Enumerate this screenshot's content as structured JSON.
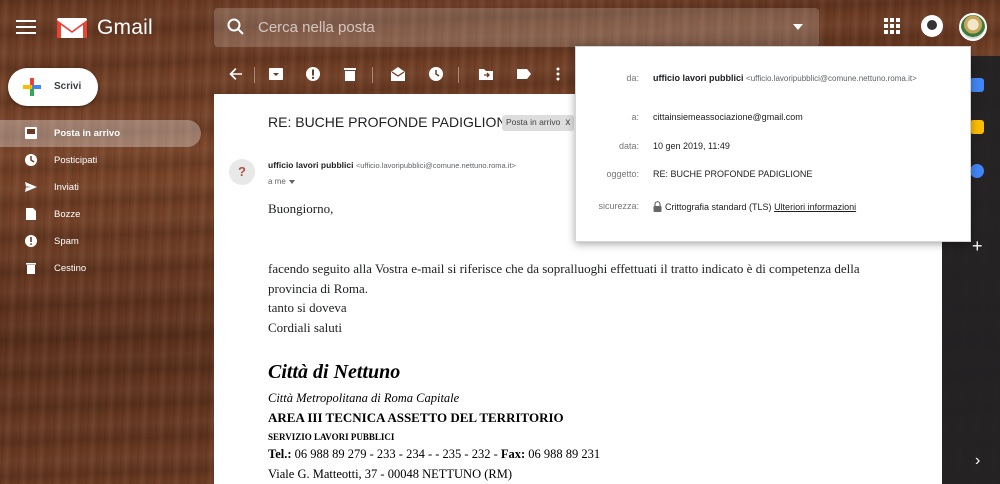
{
  "app": {
    "name": "Gmail"
  },
  "search": {
    "placeholder": "Cerca nella posta"
  },
  "compose": {
    "label": "Scrivi"
  },
  "nav": {
    "items": [
      {
        "label": "Posta in arrivo",
        "icon": "inbox-icon"
      },
      {
        "label": "Posticipati",
        "icon": "clock-icon"
      },
      {
        "label": "Inviati",
        "icon": "send-icon"
      },
      {
        "label": "Bozze",
        "icon": "draft-icon"
      },
      {
        "label": "Spam",
        "icon": "spam-icon"
      },
      {
        "label": "Cestino",
        "icon": "trash-icon"
      }
    ]
  },
  "toolbar": {
    "icons": [
      "back-arrow-icon",
      "archive-icon",
      "report-spam-icon",
      "delete-icon",
      "mark-unread-icon",
      "snooze-icon",
      "move-to-icon",
      "label-icon",
      "more-icon"
    ]
  },
  "email": {
    "subject": "RE: BUCHE PROFONDE PADIGLIONE",
    "label_chip": "Posta in arrivo",
    "label_chip_close": "x",
    "sender_initial": "?",
    "sender_name": "ufficio lavori pubblici",
    "sender_email": "<ufficio.lavoripubblici@comune.nettuno.roma.it>",
    "to_line": "a me",
    "greeting": "Buongiorno,",
    "body_lines": [
      "facendo seguito alla Vostra e-mail si riferisce che da sopralluoghi effettuati il tratto indicato è di competenza della",
      "provincia di Roma.",
      "tanto si doveva",
      "Cordiali saluti"
    ],
    "signature": {
      "title": "Città di Nettuno",
      "line1": "Città Metropolitana di Roma Capitale",
      "line2": "AREA III TECNICA ASSETTO DEL TERRITORIO",
      "line3": "SERVIZIO LAVORI PUBBLICI",
      "tel_label": "Tel.:",
      "tel_value": " 06 988 89 279 - 233 - 234 - - 235 - 232  - ",
      "fax_label": "Fax:",
      "fax_value": " 06 988 89 231",
      "address": "Viale G. Matteotti, 37 - 00048 NETTUNO (RM)"
    }
  },
  "details_popup": {
    "from_key": "da:",
    "from_name": "ufficio lavori pubblici",
    "from_email": "<ufficio.lavoripubblici@comune.nettuno.roma.it>",
    "to_key": "a:",
    "to_value": "cittainsiemeassociazione@gmail.com",
    "date_key": "data:",
    "date_value": "10 gen 2019, 11:49",
    "subject_key": "oggetto:",
    "subject_value": "RE: BUCHE PROFONDE PADIGLIONE",
    "security_key": "sicurezza:",
    "security_value": "Crittografia standard (TLS)",
    "security_link": "Ulteriori informazioni"
  },
  "colors": {
    "accent_red": "#EA4335",
    "accent_blue": "#4285F4",
    "accent_green": "#34A853",
    "accent_yellow": "#FBBC04"
  }
}
